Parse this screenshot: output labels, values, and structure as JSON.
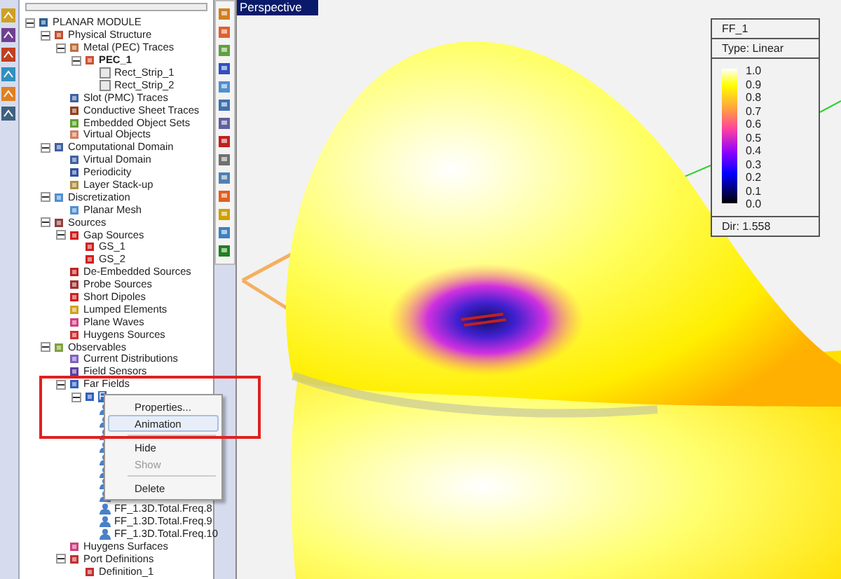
{
  "tree": [
    {
      "label": "PLANAR MODULE",
      "kind": "module",
      "expanded": true,
      "selected": false,
      "children": [
        {
          "label": "Physical Structure",
          "kind": "physical",
          "expanded": true,
          "selected": false,
          "children": [
            {
              "label": "Metal (PEC) Traces",
              "kind": "metal",
              "expanded": true,
              "selected": false,
              "children": [
                {
                  "label": "PEC_1",
                  "kind": "pec",
                  "bold": true,
                  "expanded": true,
                  "selected": false,
                  "children": [
                    {
                      "label": "Rect_Strip_1",
                      "kind": "strip",
                      "selected": false
                    },
                    {
                      "label": "Rect_Strip_2",
                      "kind": "strip",
                      "selected": false
                    }
                  ]
                }
              ]
            },
            {
              "label": "Slot (PMC) Traces",
              "kind": "slot",
              "selected": false
            },
            {
              "label": "Conductive Sheet Traces",
              "kind": "sheet",
              "selected": false
            },
            {
              "label": "Embedded Object Sets",
              "kind": "embedded",
              "selected": false
            },
            {
              "label": "Virtual Objects",
              "kind": "virtual",
              "selected": false
            }
          ]
        },
        {
          "label": "Computational Domain",
          "kind": "domain",
          "expanded": true,
          "selected": false,
          "children": [
            {
              "label": "Virtual Domain",
              "kind": "domain",
              "selected": false
            },
            {
              "label": "Periodicity",
              "kind": "grid",
              "selected": false
            },
            {
              "label": "Layer Stack-up",
              "kind": "layers",
              "selected": false
            }
          ]
        },
        {
          "label": "Discretization",
          "kind": "mesh",
          "expanded": true,
          "selected": false,
          "children": [
            {
              "label": "Planar Mesh",
              "kind": "mesh",
              "selected": false
            }
          ]
        },
        {
          "label": "Sources",
          "kind": "sources",
          "expanded": true,
          "selected": false,
          "children": [
            {
              "label": "Gap Sources",
              "kind": "gap",
              "expanded": true,
              "selected": false,
              "children": [
                {
                  "label": "GS_1",
                  "kind": "gap",
                  "selected": false
                },
                {
                  "label": "GS_2",
                  "kind": "gap",
                  "selected": false
                }
              ]
            },
            {
              "label": "De-Embedded Sources",
              "kind": "deembed",
              "selected": false
            },
            {
              "label": "Probe Sources",
              "kind": "probe",
              "selected": false
            },
            {
              "label": "Short Dipoles",
              "kind": "gap",
              "selected": false
            },
            {
              "label": "Lumped Elements",
              "kind": "lumped",
              "selected": false
            },
            {
              "label": "Plane Waves",
              "kind": "wave",
              "selected": false
            },
            {
              "label": "Huygens Sources",
              "kind": "huygens",
              "selected": false
            }
          ]
        },
        {
          "label": "Observables",
          "kind": "observables",
          "expanded": true,
          "selected": false,
          "children": [
            {
              "label": "Current Distributions",
              "kind": "current",
              "selected": false
            },
            {
              "label": "Field Sensors",
              "kind": "sensor",
              "selected": false
            },
            {
              "label": "Far Fields",
              "kind": "farfield",
              "expanded": true,
              "selected": false,
              "children": [
                {
                  "label": "F",
                  "kind": "farfield",
                  "expanded": true,
                  "selected": true,
                  "children": [
                    {
                      "kind": "person",
                      "selected": false
                    },
                    {
                      "kind": "person",
                      "selected": false
                    },
                    {
                      "kind": "person",
                      "selected": false
                    },
                    {
                      "kind": "person",
                      "selected": false
                    },
                    {
                      "kind": "person",
                      "selected": false
                    },
                    {
                      "kind": "person",
                      "selected": false
                    },
                    {
                      "kind": "person",
                      "selected": false
                    },
                    {
                      "kind": "person",
                      "selected": false
                    },
                    {
                      "label": "FF_1.3D.Total.Freq.8",
                      "kind": "person",
                      "selected": false
                    },
                    {
                      "label": "FF_1.3D.Total.Freq.9",
                      "kind": "person",
                      "selected": false
                    },
                    {
                      "label": "FF_1.3D.Total.Freq.10",
                      "kind": "person",
                      "selected": false
                    }
                  ]
                }
              ]
            },
            {
              "label": "Huygens Surfaces",
              "kind": "wave",
              "selected": false
            },
            {
              "label": "Port Definitions",
              "kind": "port",
              "expanded": true,
              "selected": false,
              "children": [
                {
                  "label": "Definition_1",
                  "kind": "port",
                  "selected": false
                }
              ]
            }
          ]
        }
      ]
    }
  ],
  "context_menu": [
    {
      "label": "Properties...",
      "highlighted": false,
      "disabled": false
    },
    {
      "label": "Animation",
      "highlighted": true,
      "disabled": false,
      "separator_after": true
    },
    {
      "label": "Hide",
      "highlighted": false,
      "disabled": false
    },
    {
      "label": "Show",
      "highlighted": false,
      "disabled": true,
      "separator_after": true
    },
    {
      "label": "Delete",
      "highlighted": false,
      "disabled": false
    }
  ],
  "viewport": {
    "title": "Perspective"
  },
  "legend": {
    "title": "FF_1",
    "type": "Type: Linear",
    "ticks": [
      "1.0",
      "0.9",
      "0.8",
      "0.7",
      "0.6",
      "0.5",
      "0.4",
      "0.3",
      "0.2",
      "0.1",
      "0.0"
    ],
    "footer": "Dir: 1.558"
  }
}
